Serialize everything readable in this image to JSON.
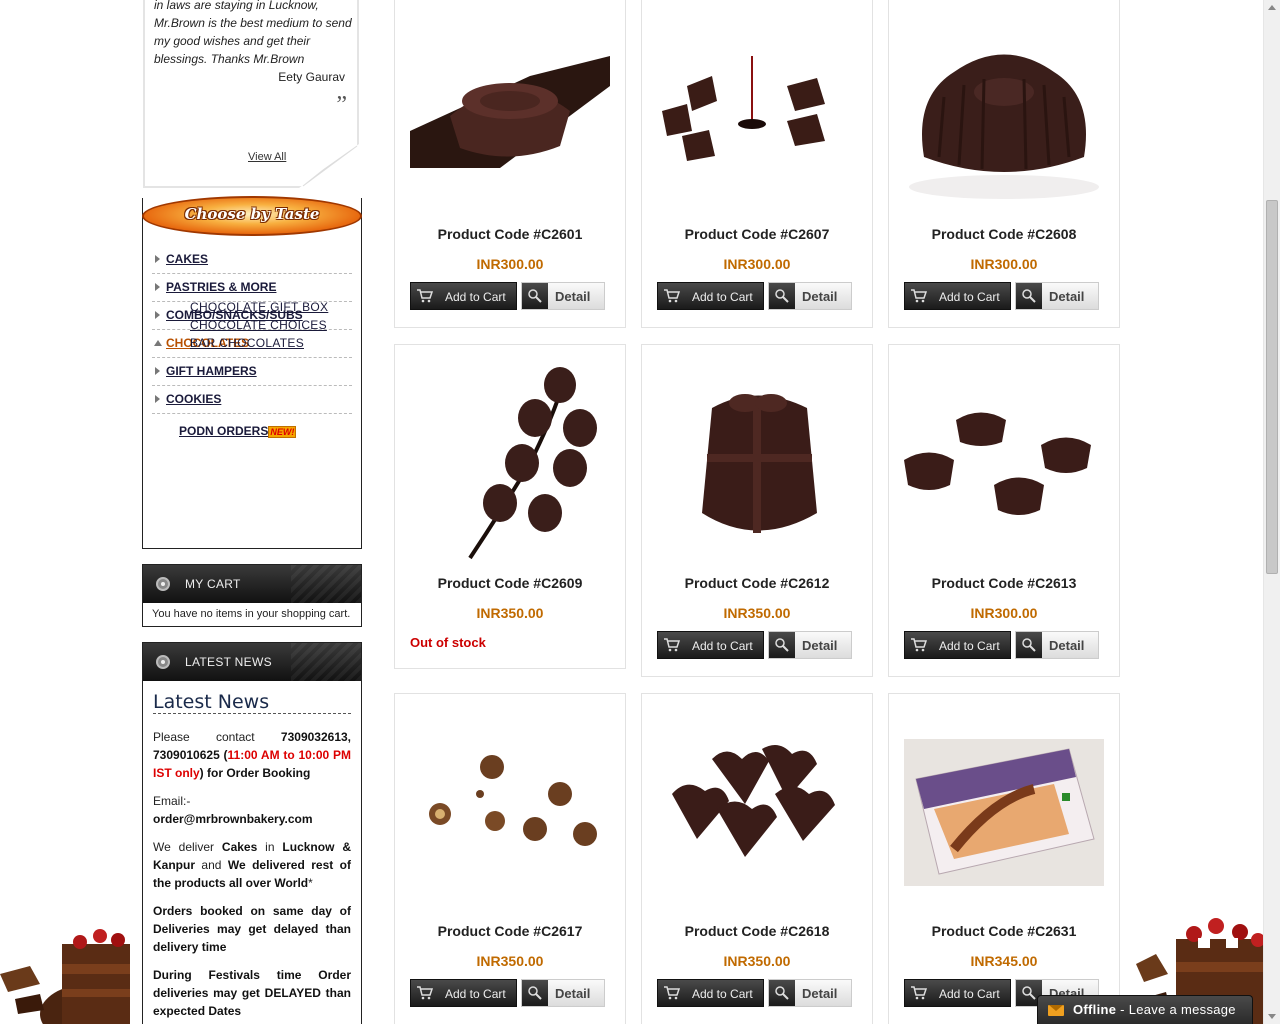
{
  "testimonial": {
    "text": "in laws are staying in Lucknow, Mr.Brown is the best medium to send my good wishes and get their blessings. Thanks Mr.Brown",
    "author": "Eety Gaurav",
    "close_quote": "”",
    "view_all": "View All"
  },
  "taste": {
    "title": "Choose by Taste",
    "categories": [
      {
        "label": "CAKES"
      },
      {
        "label": "PASTRIES & MORE"
      },
      {
        "label": "COMBO/SNACKS/SUBS"
      },
      {
        "label": "CHOCOLATES",
        "subs": [
          "CHOCOLATE GIFT BOX",
          "CHOCOLATE CHOICES",
          "BAR CHOCOLATES"
        ]
      },
      {
        "label": "GIFT HAMPERS"
      },
      {
        "label": "COOKIES"
      }
    ],
    "podn": "PODN ORDERS",
    "new_badge": "NEW!"
  },
  "cart": {
    "title": "MY CART",
    "empty_text": "You have no items in your shopping cart."
  },
  "news": {
    "header": "LATEST NEWS",
    "title": "Latest News",
    "p1_a": "Please contact ",
    "p1_phones": "7309032613, 7309010625",
    "p1_b": " (",
    "p1_time": "11:00 AM to 10:00 PM IST only",
    "p1_c": ") for Order Booking",
    "email_label": "Email:-",
    "email": "order@mrbrownbakery.com",
    "p3_a": "We deliver ",
    "p3_cakes": "Cakes",
    "p3_b": " in ",
    "p3_cities": "Lucknow & Kanpur",
    "p3_c": " and ",
    "p3_d": "We delivered rest of the products all over World",
    "p3_star": "*",
    "p4": "Orders booked on same day of Deliveries may get delayed than delivery time",
    "p5": "During Festivals time Order deliveries may get DELAYED than expected Dates"
  },
  "buttons": {
    "add_to_cart": "Add to Cart",
    "detail": "Detail"
  },
  "products": [
    {
      "code": "Product Code #C2601",
      "price": "INR300.00",
      "in_stock": true
    },
    {
      "code": "Product Code #C2607",
      "price": "INR300.00",
      "in_stock": true
    },
    {
      "code": "Product Code #C2608",
      "price": "INR300.00",
      "in_stock": true
    },
    {
      "code": "Product Code #C2609",
      "price": "INR350.00",
      "in_stock": false,
      "stock_text": "Out of stock"
    },
    {
      "code": "Product Code #C2612",
      "price": "INR350.00",
      "in_stock": true
    },
    {
      "code": "Product Code #C2613",
      "price": "INR300.00",
      "in_stock": true
    },
    {
      "code": "Product Code #C2617",
      "price": "INR350.00",
      "in_stock": true
    },
    {
      "code": "Product Code #C2618",
      "price": "INR350.00",
      "in_stock": true
    },
    {
      "code": "Product Code #C2631",
      "price": "INR345.00",
      "in_stock": true
    }
  ],
  "chat": {
    "status": "Offline",
    "message": " - Leave a message"
  }
}
